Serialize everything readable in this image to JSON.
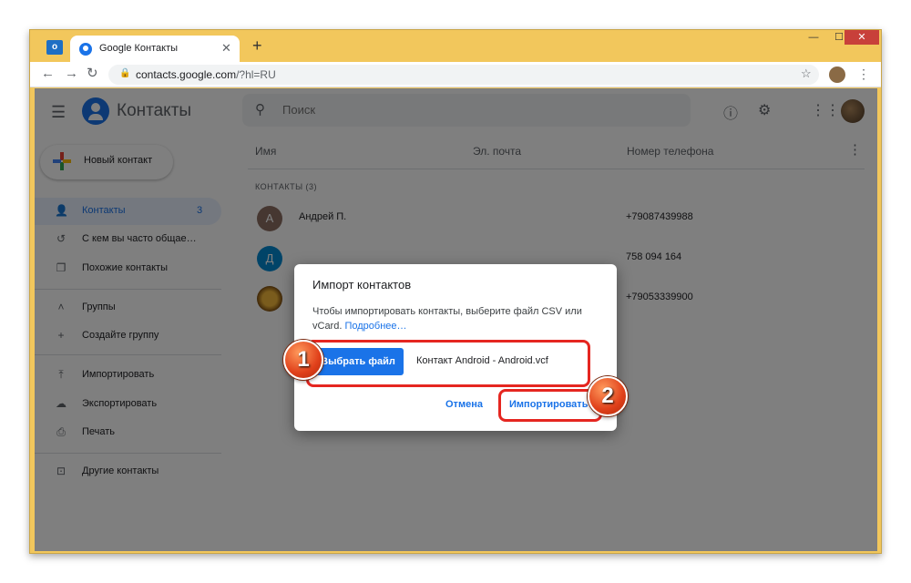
{
  "browser": {
    "tab_title": "Google Контакты",
    "tab_close": "✕",
    "new_tab": "+",
    "url_host": "contacts.google.com",
    "url_path": "/?hl=RU",
    "window_controls": {
      "minimize": "—",
      "maximize": "☐",
      "close": "✕"
    }
  },
  "header": {
    "app_name": "Контакты",
    "search_placeholder": "Поиск"
  },
  "sidebar": {
    "new_contact": "Новый контакт",
    "items": [
      {
        "label": "Контакты",
        "count": "3",
        "icon": "person-icon"
      },
      {
        "label": "С кем вы часто общае…",
        "icon": "history-icon"
      },
      {
        "label": "Похожие контакты",
        "icon": "copy-icon"
      },
      {
        "label": "Группы",
        "icon": "chevron-up-icon"
      },
      {
        "label": "Создайте группу",
        "icon": "plus-icon"
      },
      {
        "label": "Импортировать",
        "icon": "upload-icon"
      },
      {
        "label": "Экспортировать",
        "icon": "cloud-download-icon"
      },
      {
        "label": "Печать",
        "icon": "print-icon"
      },
      {
        "label": "Другие контакты",
        "icon": "archive-icon"
      }
    ]
  },
  "list": {
    "columns": [
      "Имя",
      "Эл. почта",
      "Номер телефона"
    ],
    "section_label": "КОНТАКТЫ (3)",
    "rows": [
      {
        "initial": "А",
        "name": "Андрей П.",
        "phone": "+79087439988",
        "color": "#8d6e63"
      },
      {
        "initial": "Д",
        "name": "",
        "phone": "758 094 164",
        "color": "#0288d1"
      },
      {
        "initial": "",
        "name": "",
        "phone": "+79053339900",
        "color": "#e8a317"
      }
    ]
  },
  "dialog": {
    "title": "Импорт контактов",
    "text": "Чтобы импортировать контакты, выберите файл CSV или vCard.",
    "link": "Подробнее…",
    "choose_file": "Выбрать файл",
    "file_name": "Контакт Android - Android.vcf",
    "cancel": "Отмена",
    "import": "Импортировать"
  },
  "annotations": {
    "step1": "1",
    "step2": "2",
    "highlight_color": "#e52620"
  }
}
